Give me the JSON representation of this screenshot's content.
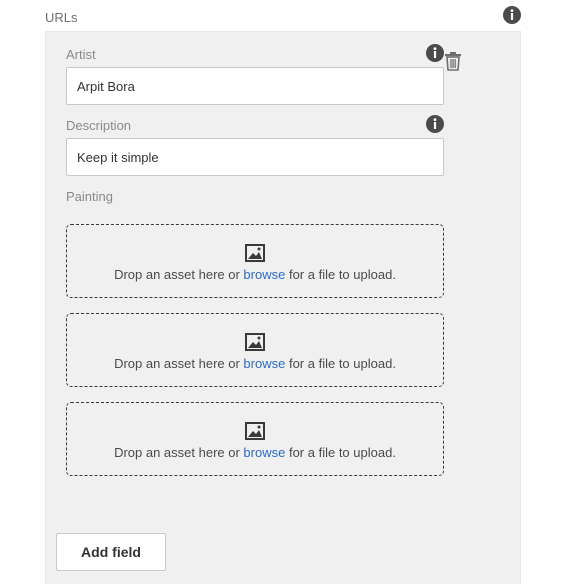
{
  "section": {
    "label": "URLs",
    "info_icon": "info-icon"
  },
  "fields": {
    "artist": {
      "label": "Artist",
      "value": "Arpit Bora",
      "info_icon": "info-icon",
      "delete_icon": "trash-icon"
    },
    "description": {
      "label": "Description",
      "value": "Keep it simple",
      "info_icon": "info-icon"
    },
    "painting": {
      "label": "Painting",
      "dropzones": [
        {
          "icon": "image-icon",
          "text_before": "Drop an asset here or",
          "link": "browse",
          "text_after": "for a file to upload."
        },
        {
          "icon": "image-icon",
          "text_before": "Drop an asset here or",
          "link": "browse",
          "text_after": "for a file to upload."
        },
        {
          "icon": "image-icon",
          "text_before": "Drop an asset here or",
          "link": "browse",
          "text_after": "for a file to upload."
        }
      ]
    }
  },
  "actions": {
    "add_field_label": "Add field"
  },
  "colors": {
    "link": "#2d6bbf",
    "panel_bg": "#f0f0f0",
    "icon": "#4b4b4b"
  }
}
